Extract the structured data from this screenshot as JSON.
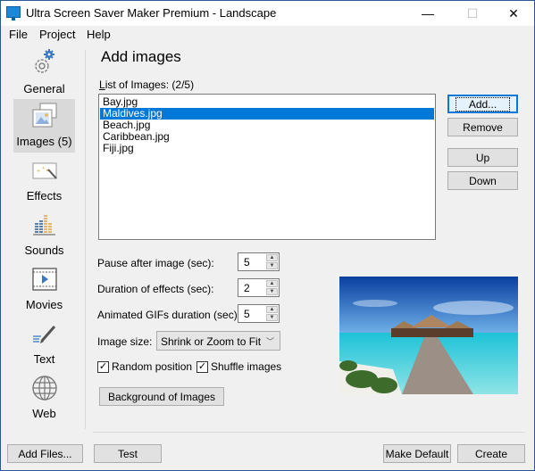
{
  "window": {
    "title": "Ultra Screen Saver Maker Premium - Landscape",
    "controls": {
      "minimize": "—",
      "maximize": "☐",
      "close": "✕"
    }
  },
  "menu": [
    "File",
    "Project",
    "Help"
  ],
  "sidebar": {
    "items": [
      {
        "label": "General",
        "icon": "gear-icon",
        "active": false
      },
      {
        "label": "Images (5)",
        "icon": "images-icon",
        "active": true
      },
      {
        "label": "Effects",
        "icon": "magic-wand-icon",
        "active": false
      },
      {
        "label": "Sounds",
        "icon": "equalizer-icon",
        "active": false
      },
      {
        "label": "Movies",
        "icon": "film-icon",
        "active": false
      },
      {
        "label": "Text",
        "icon": "pen-icon",
        "active": false
      },
      {
        "label": "Web",
        "icon": "globe-icon",
        "active": false
      }
    ]
  },
  "main": {
    "heading": "Add images",
    "list_label_prefix": "L",
    "list_label_rest": "ist of Images:",
    "list_count": "(2/5)",
    "images": [
      "Bay.jpg",
      "Maldives.jpg",
      "Beach.jpg",
      "Caribbean.jpg",
      "Fiji.jpg"
    ],
    "selected_index": 1,
    "buttons": {
      "add": "Add...",
      "remove": "Remove",
      "up": "Up",
      "down": "Down",
      "background": "Background of Images"
    },
    "fields": {
      "pause_label": "Pause after image (sec):",
      "pause_value": "5",
      "duration_label": "Duration of effects (sec):",
      "duration_value": "2",
      "gif_label": "Animated GIFs duration (sec):",
      "gif_value": "5",
      "size_label": "Image size:",
      "size_value": "Shrink or Zoom to Fit"
    },
    "checkboxes": {
      "random_label": "Random position",
      "random_checked": true,
      "shuffle_label": "Shuffle images",
      "shuffle_checked": true
    },
    "preview_alt": "Maldives overwater bungalows with wooden pier"
  },
  "footer": {
    "add_files": "Add Files...",
    "test": "Test",
    "make_default": "Make Default",
    "create": "Create"
  },
  "colors": {
    "selection": "#0078d7",
    "sidebar_active": "#d9d9d9",
    "window_bg": "#f0f0f0"
  }
}
